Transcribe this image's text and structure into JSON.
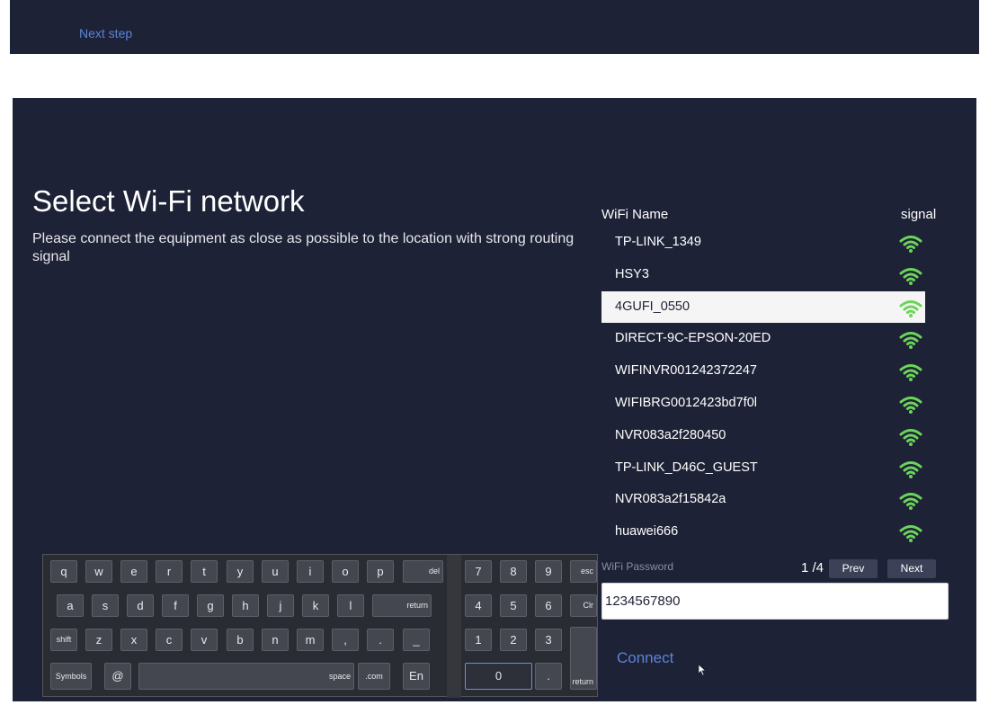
{
  "top": {
    "next_step": "Next step"
  },
  "main": {
    "title": "Select Wi-Fi network",
    "subtitle": "Please connect the equipment as close as possible to the location with strong routing signal",
    "wifi_header": "WiFi Name",
    "signal_header": "signal",
    "networks": [
      {
        "name": "TP-LINK_1349",
        "selected": false
      },
      {
        "name": "HSY3",
        "selected": false
      },
      {
        "name": "4GUFI_0550",
        "selected": true
      },
      {
        "name": "DIRECT-9C-EPSON-20ED",
        "selected": false
      },
      {
        "name": "WIFINVR001242372247",
        "selected": false
      },
      {
        "name": "WIFIBRG0012423bd7f0l",
        "selected": false
      },
      {
        "name": "NVR083a2f280450",
        "selected": false
      },
      {
        "name": "TP-LINK_D46C_GUEST",
        "selected": false
      },
      {
        "name": "NVR083a2f15842a",
        "selected": false
      },
      {
        "name": "huawei666",
        "selected": false
      }
    ],
    "password_label": "WiFi Password",
    "page_indicator": "1 /4",
    "prev_label": "Prev",
    "next_label": "Next",
    "password_value": "1234567890",
    "connect_label": "Connect"
  },
  "colors": {
    "panel_bg": "#1e2236",
    "accent": "#5b84d6",
    "signal_green": "#6cd45a"
  },
  "keyboard": {
    "rows": [
      [
        "q",
        "w",
        "e",
        "r",
        "t",
        "y",
        "u",
        "i",
        "o",
        "p",
        "del",
        "7",
        "8",
        "9",
        "esc"
      ],
      [
        "a",
        "s",
        "d",
        "f",
        "g",
        "h",
        "j",
        "k",
        "l",
        "return",
        "4",
        "5",
        "6",
        "Clr"
      ],
      [
        "shift",
        "z",
        "x",
        "c",
        "v",
        "b",
        "n",
        "m",
        ",",
        ".",
        "_",
        "1",
        "2",
        "3"
      ],
      [
        "Symbols",
        "@",
        "space",
        ".com",
        "En",
        "0",
        ".",
        "return"
      ]
    ]
  }
}
